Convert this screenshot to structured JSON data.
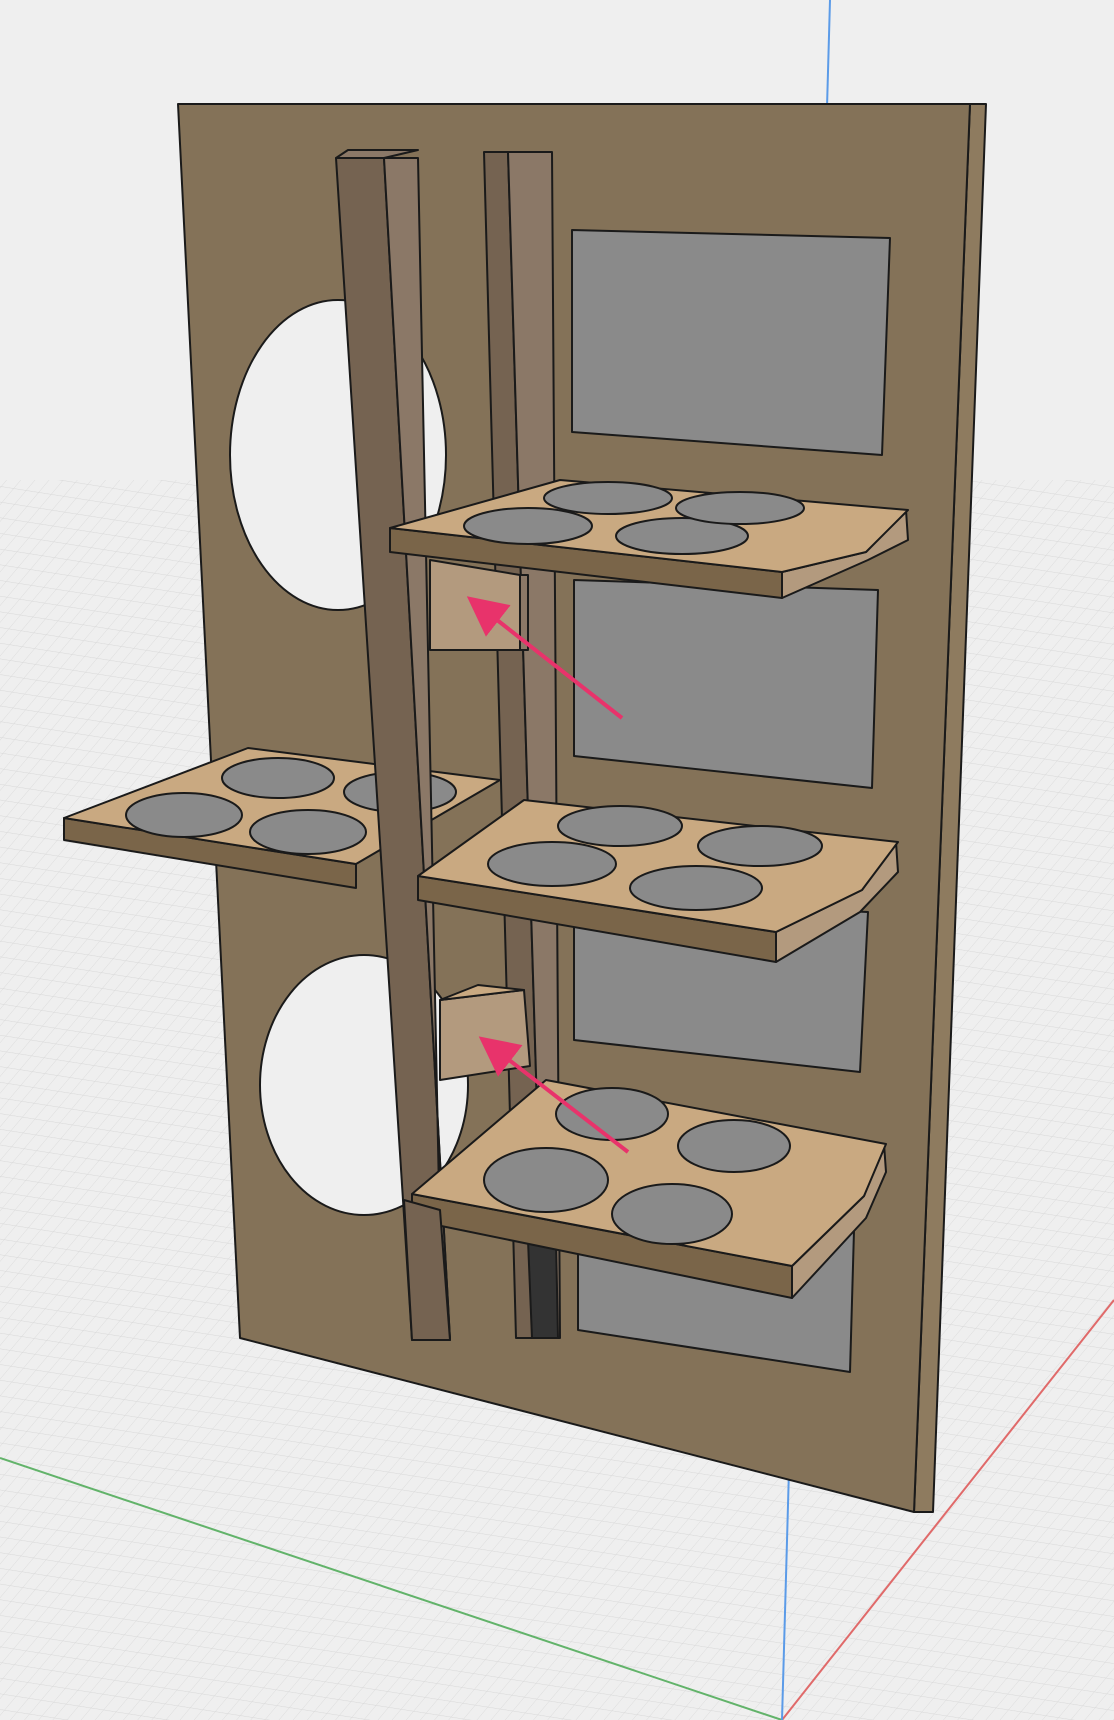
{
  "viewport": {
    "background": "#efefef",
    "grid_minor": "#d6d6d6",
    "grid_major": "#c4c4c4"
  },
  "axes": {
    "x_color": "#e06a6a",
    "y_color": "#62b36a",
    "z_color": "#5b9be8"
  },
  "model": {
    "panel_color": "#847258",
    "panel_edge": "#8e7b5f",
    "cutout_color": "#8a8a8a",
    "post_color": "#756351",
    "post_light": "#8b7867",
    "shelf_top": "#c9a981",
    "shelf_edge": "#7a6549",
    "hole_color": "#8a8a8a",
    "outline": "#1a1a1a"
  },
  "annotations": {
    "arrow_color": "#e8336b"
  }
}
